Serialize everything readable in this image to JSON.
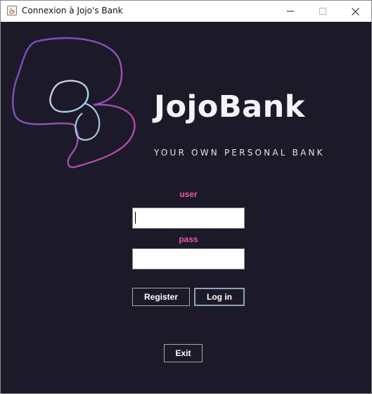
{
  "window": {
    "title": "Connexion à Jojo's Bank",
    "icon": "java-cup-icon",
    "controls": [
      "minimize-icon",
      "maximize-icon",
      "close-icon"
    ]
  },
  "brand": {
    "name": "JojoBank",
    "tagline": "YOUR OWN PERSONAL BANK"
  },
  "login_form": {
    "user_label": "user",
    "user_value": "",
    "pass_label": "pass",
    "pass_value": ""
  },
  "buttons": {
    "register": "Register",
    "login": "Log in",
    "exit": "Exit"
  },
  "colors": {
    "background": "#1c1a29",
    "label_accent": "#e75aa0",
    "brand_text": "#f4f3f8",
    "logo_gradient": [
      "#6f4fc0",
      "#b84aa6",
      "#8fd6e8"
    ]
  }
}
